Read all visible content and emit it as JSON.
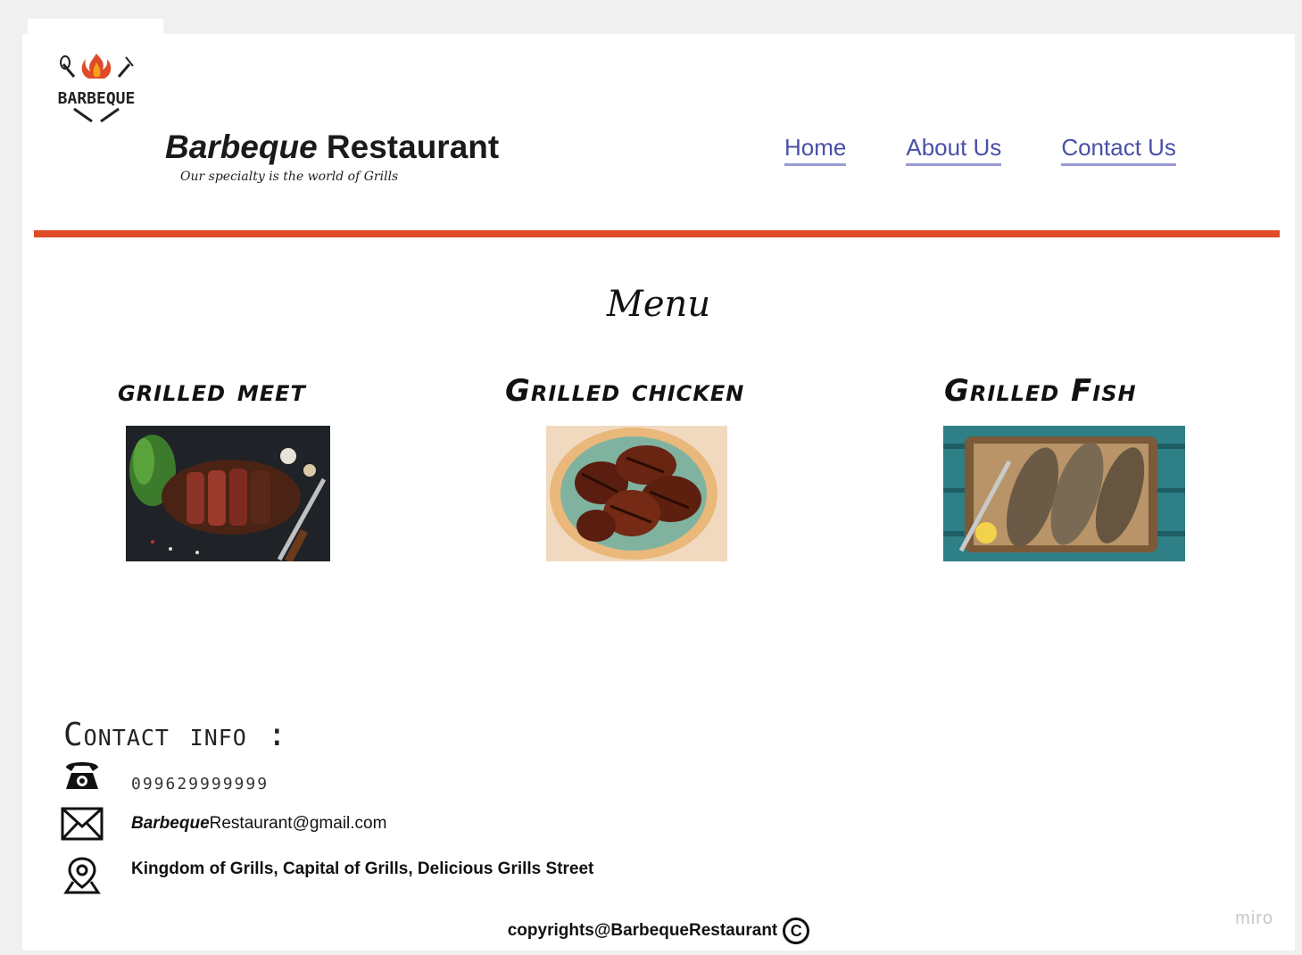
{
  "header": {
    "brand_italic": "Barbeque",
    "brand_rest": " Restaurant",
    "tagline": "Our specialty is the world of Grills",
    "logo_text": "BARBEQUE"
  },
  "nav": {
    "items": [
      {
        "label": "Home"
      },
      {
        "label": "About Us"
      },
      {
        "label": "Contact Us"
      }
    ]
  },
  "menu": {
    "title": "Menu",
    "dishes": [
      {
        "title": "grilled meet",
        "image": "grilled-steak-photo"
      },
      {
        "title": "Grilled chicken",
        "image": "grilled-chicken-photo"
      },
      {
        "title": "Grilled Fish",
        "image": "grilled-fish-photo"
      }
    ]
  },
  "contact": {
    "heading": "Contact info :",
    "phone": "099629999999",
    "email_italic": "Barbeque",
    "email_rest": "Restaurant@gmail.com",
    "address": "Kingdom of Grills, Capital of Grills, Delicious Grills Street"
  },
  "footer": {
    "copyright": "copyrights@BarbequeRestaurant",
    "copyright_symbol": "C"
  },
  "watermark": "miro",
  "colors": {
    "accent_rule": "#e04b2a",
    "nav_link": "#4a4fa8",
    "nav_underline": "#9a9ad4"
  }
}
